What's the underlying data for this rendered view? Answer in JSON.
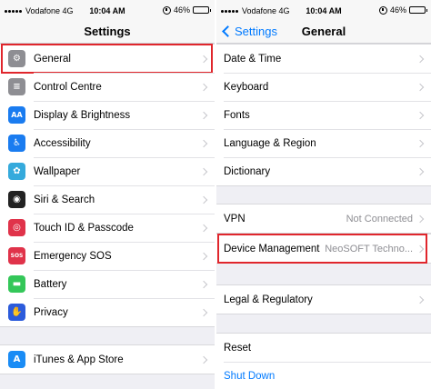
{
  "left": {
    "status": {
      "carrier": "Vodafone 4G",
      "time": "10:04 AM",
      "battery": "46%",
      "battery_level": 0.46
    },
    "nav_title": "Settings",
    "group1": [
      {
        "label": "General",
        "icon": "gear-icon",
        "color": "#8e8e93",
        "glyph": "⚙",
        "highlighted": true
      },
      {
        "label": "Control Centre",
        "icon": "toggles-icon",
        "color": "#8e8e93",
        "glyph": "≡"
      },
      {
        "label": "Display & Brightness",
        "icon": "aa-icon",
        "color": "#1a7cf0",
        "glyph": "AA"
      },
      {
        "label": "Accessibility",
        "icon": "accessibility-person-icon",
        "color": "#1a7cf0",
        "glyph": "♿"
      },
      {
        "label": "Wallpaper",
        "icon": "flower-icon",
        "color": "#35aadc",
        "glyph": "✿"
      },
      {
        "label": "Siri & Search",
        "icon": "siri-icon",
        "color": "#222222",
        "glyph": "◉"
      },
      {
        "label": "Touch ID & Passcode",
        "icon": "fingerprint-icon",
        "color": "#e0334a",
        "glyph": "◎"
      },
      {
        "label": "Emergency SOS",
        "icon": "sos-icon",
        "color": "#e0334a",
        "glyph": "SOS"
      },
      {
        "label": "Battery",
        "icon": "battery-icon",
        "color": "#34c759",
        "glyph": "▬"
      },
      {
        "label": "Privacy",
        "icon": "hand-icon",
        "color": "#2c5bdb",
        "glyph": "✋"
      }
    ],
    "group2": [
      {
        "label": "iTunes & App Store",
        "icon": "app-store-icon",
        "color": "#1a8cf5",
        "glyph": "A"
      }
    ]
  },
  "right": {
    "status": {
      "carrier": "Vodafone 4G",
      "time": "10:04 AM",
      "battery": "46%",
      "battery_level": 0.46
    },
    "back_label": "Settings",
    "nav_title": "General",
    "group1": [
      {
        "label": "Date & Time"
      },
      {
        "label": "Keyboard"
      },
      {
        "label": "Fonts"
      },
      {
        "label": "Language & Region"
      },
      {
        "label": "Dictionary"
      }
    ],
    "group2": [
      {
        "label": "VPN",
        "value": "Not Connected"
      }
    ],
    "group3": [
      {
        "label": "Device Management",
        "value": "NeoSOFT Techno...",
        "highlighted": true
      }
    ],
    "group4": [
      {
        "label": "Legal & Regulatory"
      }
    ],
    "group5": [
      {
        "label": "Reset"
      },
      {
        "label": "Shut Down",
        "blue": true
      }
    ]
  }
}
